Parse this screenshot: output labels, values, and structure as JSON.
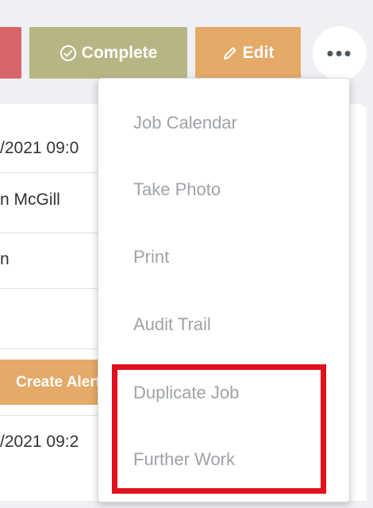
{
  "toolbar": {
    "complete_label": "Complete",
    "edit_label": "Edit",
    "more_label": "•••",
    "colors": {
      "red": "#d9656b",
      "complete": "#b7b584",
      "edit": "#e5a968"
    }
  },
  "details": {
    "rows": [
      "/2021 09:0",
      "n McGill",
      "n"
    ],
    "create_alert_label": "Create Alert",
    "last_row": "/2021 09:2"
  },
  "menu": {
    "items": [
      "Job Calendar",
      "Take Photo",
      "Print",
      "Audit Trail",
      "Duplicate Job",
      "Further Work"
    ]
  },
  "highlight": {
    "color": "#e0101c"
  }
}
